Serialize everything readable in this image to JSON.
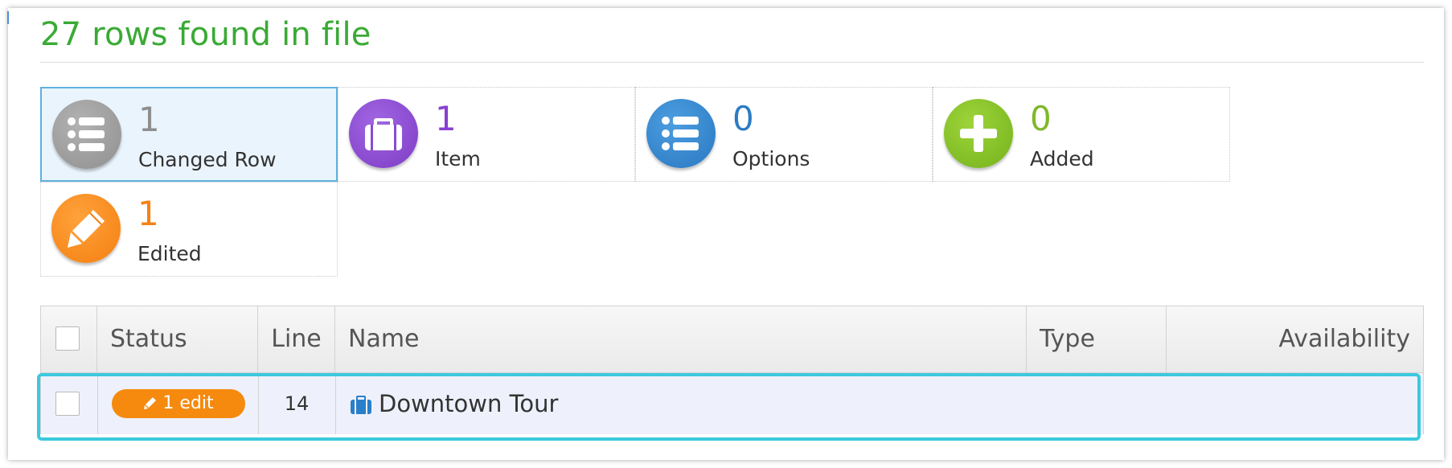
{
  "header": {
    "title": "27 rows found in file"
  },
  "summary_tiles": [
    {
      "count": "1",
      "label": "Changed Row",
      "icon": "list-icon",
      "color": "#8f8f8f",
      "selected": true
    },
    {
      "count": "1",
      "label": "Item",
      "icon": "briefcase-icon",
      "color": "#7d3cc6"
    },
    {
      "count": "0",
      "label": "Options",
      "icon": "list-icon",
      "color": "#2a78c2"
    },
    {
      "count": "0",
      "label": "Added",
      "icon": "plus-icon",
      "color": "#74b21c"
    },
    {
      "count": "1",
      "label": "Edited",
      "icon": "pencil-icon",
      "color": "#f47f10"
    }
  ],
  "table": {
    "columns": [
      "Status",
      "Line",
      "Name",
      "Type",
      "Availability"
    ],
    "rows": [
      {
        "status": "1 edit",
        "line": "14",
        "name": "Downtown Tour",
        "type": "",
        "availability": "",
        "icon": "briefcase-icon"
      }
    ]
  },
  "colors": {
    "title": "#3aaa35",
    "highlight_border": "#3cc9de",
    "edit_badge": "#f58a0f"
  }
}
